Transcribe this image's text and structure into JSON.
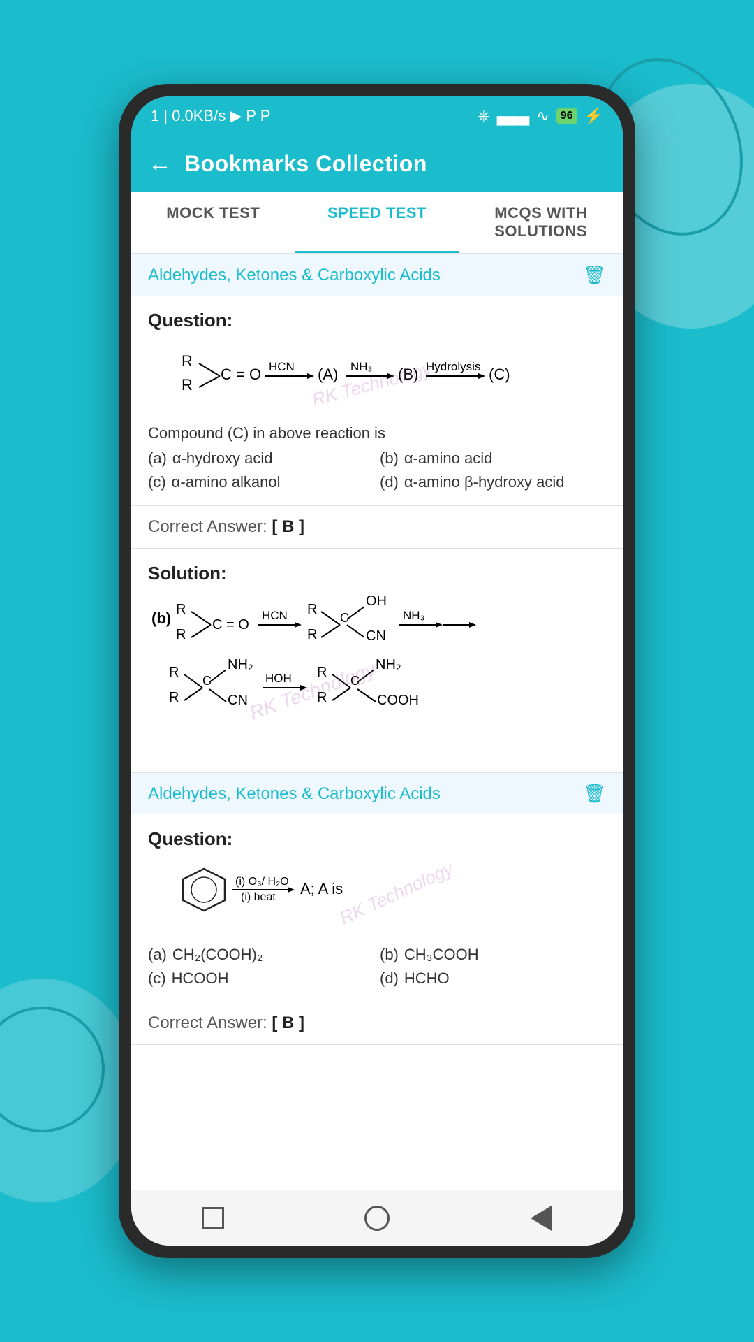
{
  "background": {
    "color": "#1bbccc"
  },
  "status_bar": {
    "left": "1  | 0.0KB/s ▶ P P",
    "battery": "96",
    "signal_icons": "bluetooth wifi signal"
  },
  "header": {
    "back_label": "←",
    "title": "Bookmarks Collection"
  },
  "tabs": [
    {
      "id": "mock",
      "label": "MOCK TEST",
      "active": false
    },
    {
      "id": "speed",
      "label": "SPEED TEST",
      "active": true
    },
    {
      "id": "mcqs",
      "label": "MCQS WITH SOLUTIONS",
      "active": false
    }
  ],
  "sections": [
    {
      "id": "section1",
      "title": "Aldehydes, Ketones & Carboxylic Acids",
      "questions": [
        {
          "id": "q1",
          "label": "Question:",
          "reaction": "R₂C=O →(HCN) (A) →(NH₃) (B) →(Hydrolysis) (C)",
          "text": "Compound (C) in above reaction is",
          "options": [
            {
              "key": "(a)",
              "text": "α-hydroxy acid"
            },
            {
              "key": "(b)",
              "text": "α-amino acid"
            },
            {
              "key": "(c)",
              "text": "α-amino alkanol"
            },
            {
              "key": "(d)",
              "text": "α-amino β-hydroxy acid"
            }
          ],
          "correct_answer": "Correct Answer:  [ B ]",
          "solution": {
            "label": "Solution:",
            "description": "(b) Reaction mechanism showing R₂C=O → (HCN) → cyanohydrin → (NH₃) → amino nitrile → (HOH) → amino acid with COOH"
          }
        }
      ]
    },
    {
      "id": "section2",
      "title": "Aldehydes, Ketones & Carboxylic Acids",
      "questions": [
        {
          "id": "q2",
          "label": "Question:",
          "reaction": "Benzene ring →(i) O₃/H₂O, (i) heat → A; A is",
          "options": [
            {
              "key": "(a)",
              "text": "CH₂(COOH)₂"
            },
            {
              "key": "(b)",
              "text": "CH₃COOH"
            },
            {
              "key": "(c)",
              "text": "HCOOH"
            },
            {
              "key": "(d)",
              "text": "HCHO"
            }
          ],
          "correct_answer": "Correct Answer:  [ B ]"
        }
      ]
    }
  ],
  "nav_bar": {
    "buttons": [
      "square",
      "circle",
      "triangle-left"
    ]
  },
  "watermark": "RK Technology"
}
